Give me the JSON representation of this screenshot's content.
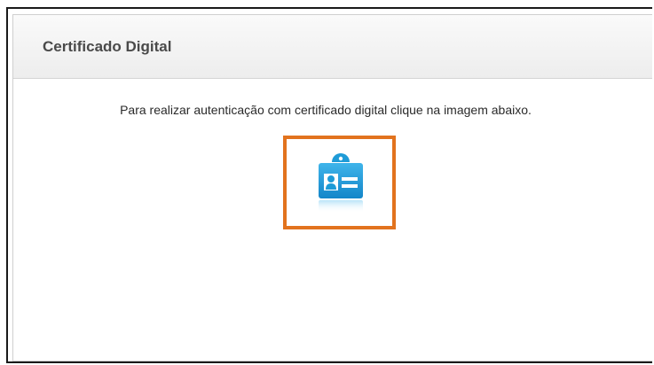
{
  "panel": {
    "title": "Certificado Digital",
    "instruction": "Para realizar autenticação com certificado digital clique na imagem abaixo.",
    "cert_icon": "id-card-icon"
  },
  "colors": {
    "highlight_border": "#e2731e",
    "icon_blue": "#1e9bd7",
    "header_text": "#4a4a4a"
  }
}
